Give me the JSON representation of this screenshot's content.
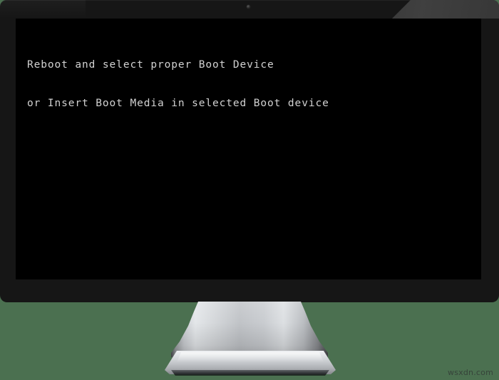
{
  "scene": {
    "background_color": "#4b7050",
    "device": "desktop-monitor"
  },
  "monitor": {
    "bezel_color": "#161616",
    "screen_color": "#000000",
    "webcam_label": "webcam"
  },
  "screen": {
    "text_color": "#d2d2d2",
    "lines": [
      "Reboot and select proper Boot Device",
      "or Insert Boot Media in selected Boot device"
    ],
    "line1": "Reboot and select proper Boot Device",
    "line2": "or Insert Boot Media in selected Boot device"
  },
  "stand": {
    "neck_label": "monitor-stand-neck",
    "base_label": "monitor-stand-base"
  },
  "watermark": {
    "text": "wsxdn.com"
  }
}
